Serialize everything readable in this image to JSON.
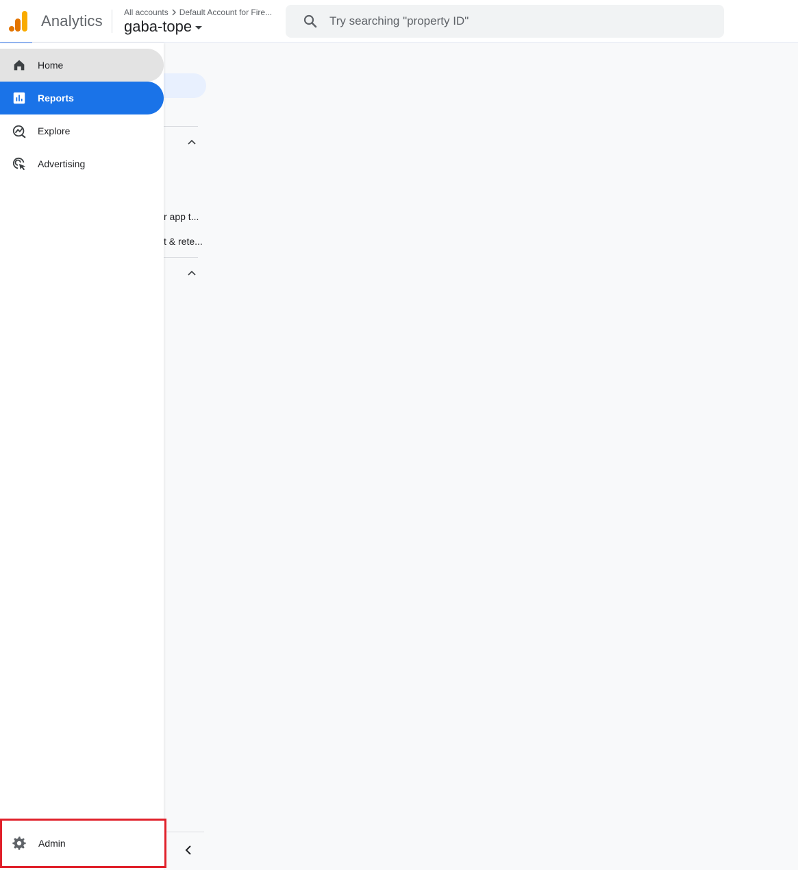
{
  "header": {
    "app_name": "Analytics",
    "breadcrumb": {
      "root": "All accounts",
      "account": "Default Account for Fire..."
    },
    "property": "gaba-tope",
    "search": {
      "placeholder": "Try searching \"property ID\""
    }
  },
  "nav": {
    "items": [
      {
        "label": "Home",
        "icon": "home-icon"
      },
      {
        "label": "Reports",
        "icon": "reports-icon",
        "active": true
      },
      {
        "label": "Explore",
        "icon": "explore-icon"
      },
      {
        "label": "Advertising",
        "icon": "advertising-icon"
      }
    ],
    "admin": {
      "label": "Admin",
      "icon": "gear-icon"
    }
  },
  "subpanel": {
    "items": [
      {
        "label": "r app t..."
      },
      {
        "label": "t & rete..."
      }
    ]
  },
  "colors": {
    "accent": "#1a73e8",
    "highlight_box": "#e0202a",
    "logo_dark": "#e37400",
    "logo_light": "#f9ab00"
  }
}
